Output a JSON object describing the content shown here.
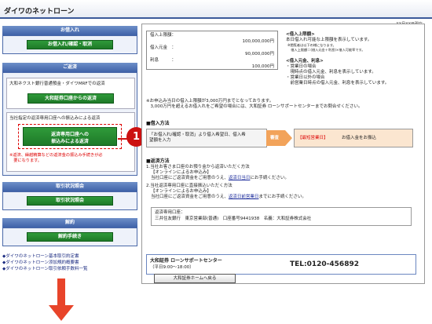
{
  "app": {
    "title": "ダイワのネットローン",
    "date": "XX月XX日現在"
  },
  "sidebar": {
    "borrow": {
      "heading": "お借入れ",
      "button": "お借入れ/確認・取消"
    },
    "repay": {
      "heading": "ご返済",
      "item1_label": "大和ネクスト銀行普通預金・ダイワMRFでの返済",
      "item1_button": "大和証券口座からの返済",
      "item2_label": "当社指定の返済専用口座への振込みによる返済",
      "item2_button_line1": "返済専用口座への",
      "item2_button_line2": "振込みによる返済",
      "note_line1": "※返済、繰越精算などの返済金の振込み手続きが必",
      "note_line2": "　要になります。"
    },
    "history": {
      "heading": "取引状況照会",
      "button": "取引状況照会"
    },
    "cancel": {
      "heading": "解約",
      "button": "解約手続き"
    },
    "links": [
      "◆ダイワのネットローン基本取引約定書",
      "◆ダイワのネットローン添加規約概要書",
      "◆ダイワのネットローン取引依頼手数料一覧"
    ],
    "callout_number": "1"
  },
  "main": {
    "limit_table": [
      {
        "label": "借入上限額：",
        "value": "100,000,000円"
      },
      {
        "label": "借入元金　：",
        "value": "90,000,000円"
      },
      {
        "label": "利息　　　：",
        "value": "100,000円"
      }
    ],
    "info": {
      "title1": "<借入上限額>",
      "line1": "本日借入れ可能な上限額を表示しています。",
      "sub1": "※閲覧者は以下の様になります。",
      "sub2": "　借入上限額＝(借入元金＋利息)×借入可能率です。",
      "title2": "<借入元金、利息>",
      "b1": "・営業日の場合",
      "b1d": "　現時点の借入元金、利息を表示しています。",
      "b2": "・営業日以外の場合",
      "b2d": "　前営業日時点の借入元金、利息を表示しています。"
    },
    "notice1": "※お申込み当日の借入上限額が3,000万円までとなっております。",
    "notice2": "　3,000万円を超えるお借入れをご希望の場合には、大和証券 ローンサポートセンターまでお問合せください。",
    "borrow_method": {
      "title": "■借入方法",
      "box_line1": "「お借入れ/確認・取消」より借入希望日、借入希",
      "box_line2": "望額を入力",
      "pay_day": "審査",
      "result_prefix": "【最短営業日】",
      "result_text": "お借入金をお振込"
    },
    "repay_method": {
      "title": "■返済方法",
      "l1": "1.当社お客さま口座のお預り金から返済いただく方法",
      "l1a": "【オンラインによるお申込み】",
      "l1b_pre": "当社口座にご返済資金をご用意のうえ、",
      "l1b_link": "返済日当日",
      "l1b_post": "にお手続ください。",
      "l2": "2.当社返済専用口座に直接振込いただく方法",
      "l2a": "【オンラインによるお申込み】",
      "l2b_pre": "当社口座にご返済資金をご用意のうえ、",
      "l2b_link": "返済日前営業日",
      "l2b_post": "までにお手続ください。",
      "acct_title": "返済専用口座：",
      "acct_detail": "三井住友銀行　東京営業部(普通)　口座番号9441938　名義：大和証券株式会社"
    },
    "support": {
      "name": "大和証券 ローンサポートセンター",
      "hours": "（平日9:00〜18:00）",
      "tel": "TEL:0120-456892"
    },
    "home_button": "大和証券ホームへ戻る"
  },
  "colors": {
    "accent_blue": "#3f62a8",
    "green": "#1e7a28",
    "red": "#d00000",
    "callout": "#cc1111",
    "arrow": "#e8442a"
  }
}
